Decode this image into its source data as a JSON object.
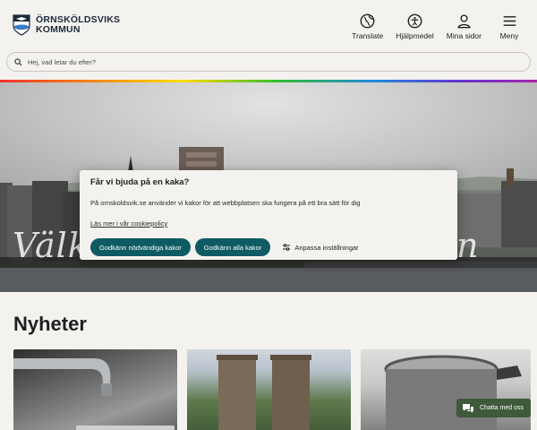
{
  "header": {
    "logo_line1": "ÖRNSKÖLDSVIKS",
    "logo_line2": "KOMMUN",
    "nav": [
      {
        "label": "Translate",
        "icon": "globe-icon"
      },
      {
        "label": "Hjälpmedel",
        "icon": "accessibility-icon"
      },
      {
        "label": "Mina sidor",
        "icon": "user-icon"
      },
      {
        "label": "Meny",
        "icon": "menu-icon"
      }
    ]
  },
  "search": {
    "placeholder": "Hej, vad letar du efter?",
    "value": ""
  },
  "hero": {
    "welcome_start": "Välko",
    "welcome_end": "n"
  },
  "news": {
    "title": "Nyheter"
  },
  "cookie": {
    "title": "Får vi bjuda på en kaka?",
    "text": "På ornskoldsvik.se använder vi kakor för att webbplatsen ska fungera på ett bra sätt för dig",
    "link": "Läs mer i vår cookiepolicy",
    "btn_necessary": "Godkänn nödvändiga kakor",
    "btn_all": "Godkänn alla kakor",
    "btn_settings": "Anpassa inställningar"
  },
  "chat": {
    "label": "Chatta med oss"
  },
  "colors": {
    "primary": "#0f5b63",
    "chat": "#3f5a3a",
    "background": "#f4f2ef"
  }
}
